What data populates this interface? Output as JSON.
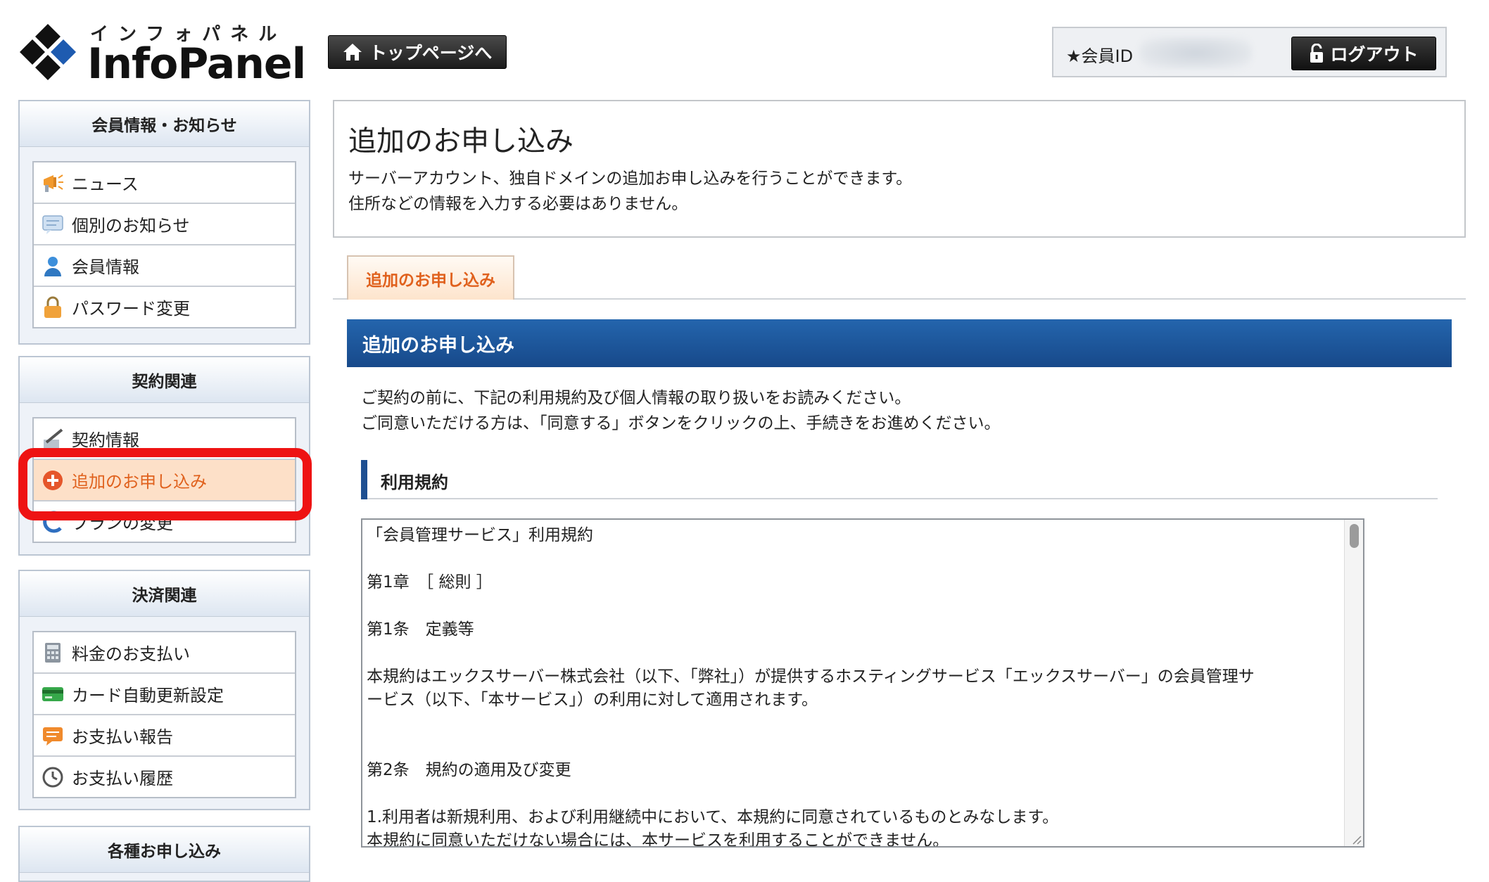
{
  "header": {
    "logo_sub": "インフォパネル",
    "logo_main": "InfoPanel",
    "top_button_label": "トップページへ",
    "member_label": "★会員ID",
    "logout_label": "ログアウト"
  },
  "sidebar": {
    "sections": [
      {
        "title": "会員情報・お知らせ",
        "items": [
          {
            "label": "ニュース",
            "icon": "megaphone-icon"
          },
          {
            "label": "個別のお知らせ",
            "icon": "speech-bubble-icon"
          },
          {
            "label": "会員情報",
            "icon": "person-icon"
          },
          {
            "label": "パスワード変更",
            "icon": "padlock-icon"
          }
        ]
      },
      {
        "title": "契約関連",
        "items": [
          {
            "label": "契約情報",
            "icon": "pen-icon"
          },
          {
            "label": "追加のお申し込み",
            "icon": "plus-circle-icon",
            "active": true
          },
          {
            "label": "プランの変更",
            "icon": "arrow-icon"
          }
        ]
      },
      {
        "title": "決済関連",
        "items": [
          {
            "label": "料金のお支払い",
            "icon": "calculator-icon"
          },
          {
            "label": "カード自動更新設定",
            "icon": "credit-card-icon"
          },
          {
            "label": "お支払い報告",
            "icon": "report-icon"
          },
          {
            "label": "お支払い履歴",
            "icon": "clock-icon"
          }
        ]
      },
      {
        "title": "各種お申し込み",
        "items": []
      }
    ]
  },
  "main": {
    "title": "追加のお申し込み",
    "description": [
      "サーバーアカウント、独自ドメインの追加お申し込みを行うことができます。",
      "住所などの情報を入力する必要はありません。"
    ],
    "tab_label": "追加のお申し込み",
    "section_title": "追加のお申し込み",
    "instructions": [
      "ご契約の前に、下記の利用規約及び個人情報の取り扱いをお読みください。",
      "ご同意いただける方は、「同意する」ボタンをクリックの上、手続きをお進めください。"
    ],
    "subsection_title": "利用規約",
    "terms": {
      "doc_title": "「会員管理サービス」利用規約",
      "chapter": "第1章　［ 総則 ］",
      "article1": "第1条　定義等",
      "article1_body_1": "本規約はエックスサーバー株式会社（以下、「弊社」）が提供するホスティングサービス「エックスサーバー」の会員管理サ",
      "article1_body_2": "ービス（以下、「本サービス」）の利用に対して適用されます。",
      "article2": "第2条　規約の適用及び変更",
      "article2_body_1": "1.利用者は新規利用、および利用継続中において、本規約に同意されているものとみなします。",
      "article2_body_2": "本規約に同意いただけない場合には、本サービスを利用することができません。"
    }
  },
  "colors": {
    "accent_orange": "#e0611d",
    "active_bg": "#fde0c8",
    "header_blue": "#1e4f91",
    "highlight_red": "#ee1313"
  }
}
